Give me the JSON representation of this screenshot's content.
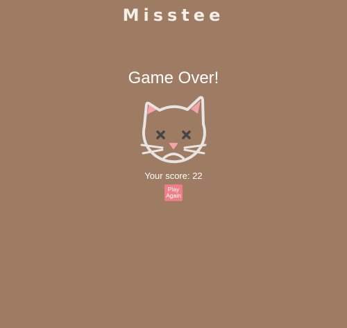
{
  "app": {
    "logo_text": "Misstee"
  },
  "game_over": {
    "title": "Game Over!",
    "score_label": "Your score:",
    "score_value": "22",
    "score_text": "Your score: 22",
    "play_again_label": "Play Again"
  },
  "icons": {
    "mascot": "dead-cat-face-icon"
  },
  "colors": {
    "background": "#9e7b63",
    "text": "#ffffff",
    "button": "#ef7f86",
    "cat_outline": "#e8e4e2",
    "cat_ear_inner": "#f4a3a8",
    "cat_eyes": "#444444"
  }
}
